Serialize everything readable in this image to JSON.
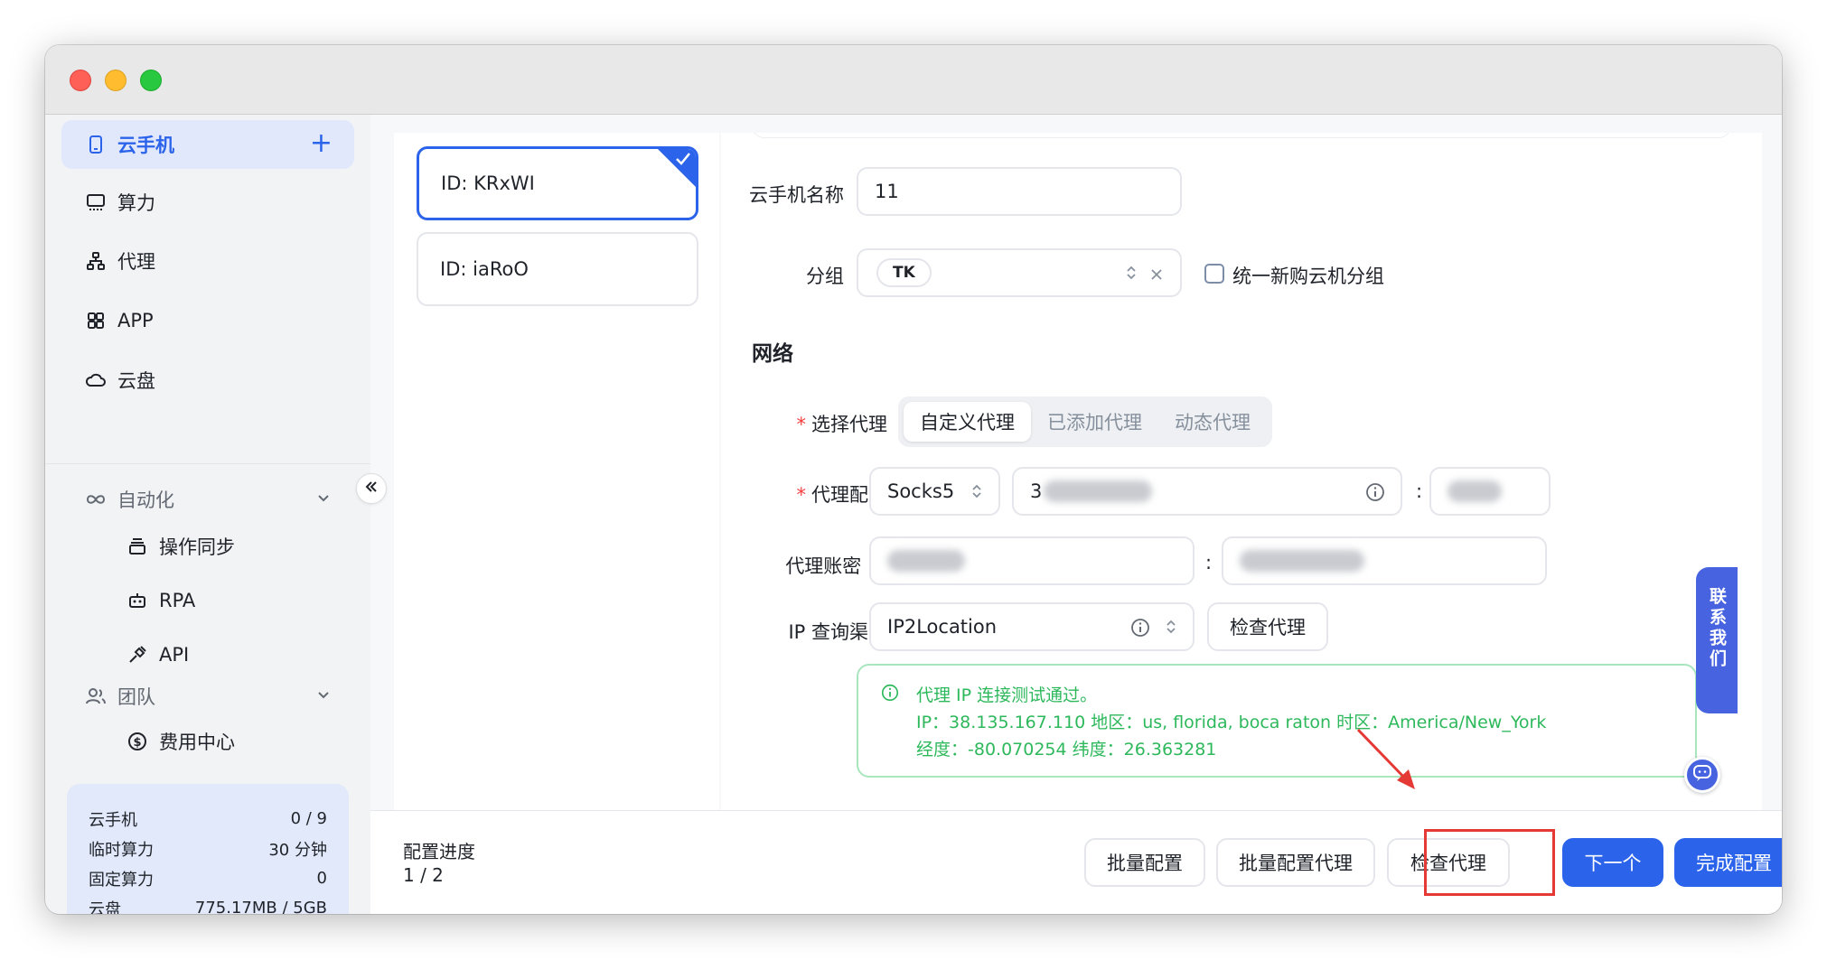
{
  "sidebar": {
    "cloud_phone": "云手机",
    "compute": "算力",
    "proxy": "代理",
    "app": "APP",
    "cloud_disk": "云盘",
    "automation": "自动化",
    "sync": "操作同步",
    "rpa": "RPA",
    "api": "API",
    "team": "团队",
    "billing": "费用中心"
  },
  "quota": {
    "rows": [
      {
        "label": "云手机",
        "value": "0 / 9"
      },
      {
        "label": "临时算力",
        "value": "30 分钟"
      },
      {
        "label": "固定算力",
        "value": "0"
      },
      {
        "label": "云盘",
        "value": "775.17MB / 5GB"
      }
    ]
  },
  "devices": [
    {
      "label": "ID: KRxWI"
    },
    {
      "label": "ID: iaRoO"
    }
  ],
  "form": {
    "name_label": "云手机名称",
    "name_value": "11",
    "group_label": "分组",
    "group_tag": "TK",
    "unify_label": "统一新购云机分组",
    "network_title": "网络",
    "select_proxy_label": "选择代理",
    "proxy_tabs": [
      "自定义代理",
      "已添加代理",
      "动态代理"
    ],
    "proxy_config_label": "代理配置",
    "protocol": "Socks5",
    "host_prefix": "3",
    "colon": ":",
    "account_label": "代理账密",
    "ip_channel_label": "IP 查询渠道",
    "ip_channel_value": "IP2Location",
    "check_proxy": "检查代理",
    "result": {
      "title": "代理 IP 连接测试通过。",
      "line2": "IP：38.135.167.110  地区：us, florida, boca raton  时区：America/New_York",
      "line3": "经度：-80.070254  纬度：26.363281"
    }
  },
  "footer": {
    "progress_label": "配置进度",
    "progress_value": "1 / 2",
    "batch_config": "批量配置",
    "batch_proxy": "批量配置代理",
    "check_proxy": "检查代理",
    "next": "下一个",
    "finish": "完成配置"
  },
  "contact": "联系我们",
  "colors": {
    "primary": "#2b63eb",
    "success": "#2eb85c",
    "highlight": "#e53935"
  }
}
